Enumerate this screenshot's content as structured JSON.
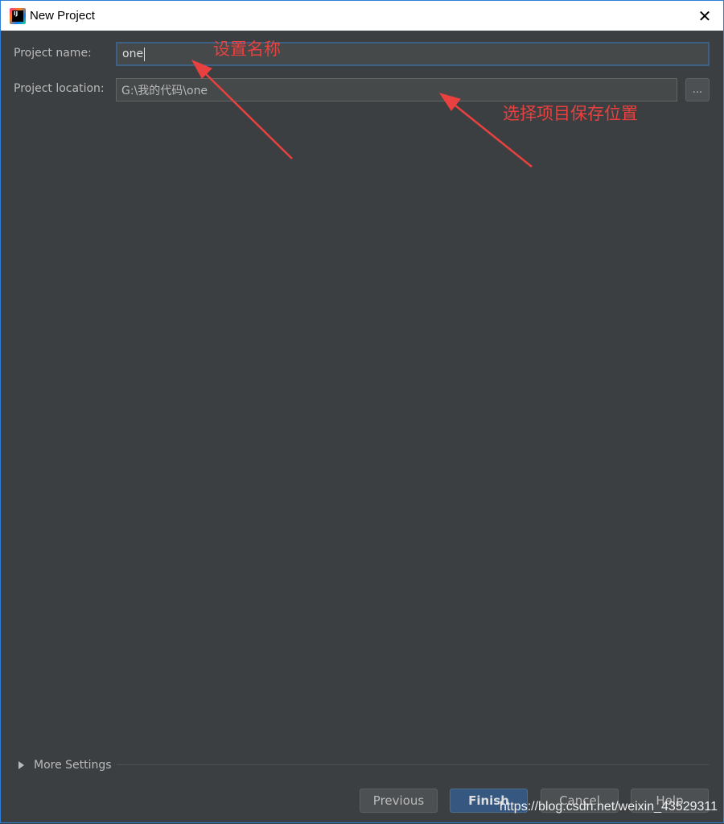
{
  "window": {
    "title": "New Project",
    "close_glyph": "✕",
    "app_icon_text": "IJ"
  },
  "form": {
    "name_label": "Project name:",
    "name_value": "one",
    "location_label": "Project location:",
    "location_value": "G:\\我的代码\\one",
    "browse_label": "..."
  },
  "annotations": {
    "name_note": "设置名称",
    "location_note": "选择项目保存位置",
    "color": "#e8413f"
  },
  "more_settings": {
    "label": "More Settings"
  },
  "buttons": {
    "previous": "Previous",
    "finish": "Finish",
    "cancel": "Cancel",
    "help": "Help"
  },
  "watermark": "https://blog.csdn.net/weixin_43529311",
  "colors": {
    "background": "#3c3f41",
    "input_bg": "#45494a",
    "focus_border": "#3d6185",
    "primary_button": "#365880",
    "text": "#bbbbbb"
  }
}
